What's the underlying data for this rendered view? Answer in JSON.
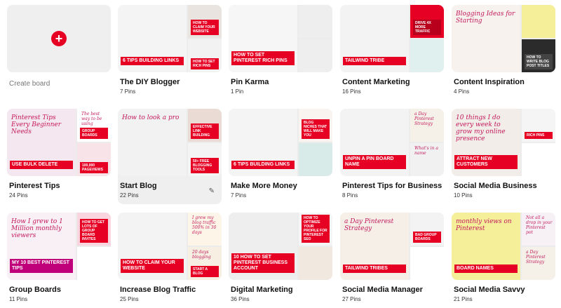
{
  "create": {
    "label": "Create board",
    "plus": "+"
  },
  "edit_glyph": "✎",
  "accent": "#e60023",
  "boards": [
    {
      "title": "The DIY Blogger",
      "count": "7 Pins",
      "tiles": [
        {
          "bg": "#f4f4f4",
          "band": "6 TIPS BUILDING LINKS",
          "bandColor": "#e60023",
          "script": ""
        },
        {
          "bg": "#e9e4df",
          "band": "HOW TO CLAIM YOUR WEBSITE",
          "bandColor": "#e60023",
          "script": ""
        },
        {
          "bg": "#f2f2f2",
          "band": "HOW TO SET RICH PINS",
          "bandColor": "#e60023",
          "script": ""
        }
      ]
    },
    {
      "title": "Pin Karma",
      "count": "1 Pin",
      "tiles": [
        {
          "bg": "#f6f6f6",
          "band": "HOW TO SET PINTEREST RICH PINS",
          "bandColor": "#e60023",
          "script": ""
        },
        {
          "bg": "#eeeeee",
          "band": "",
          "bandColor": "#e60023",
          "script": ""
        },
        {
          "bg": "#eeeeee",
          "band": "",
          "bandColor": "#e60023",
          "script": ""
        }
      ]
    },
    {
      "title": "Content Marketing",
      "count": "16 Pins",
      "tiles": [
        {
          "bg": "#f3f3f3",
          "band": "TAILWIND TRIBE",
          "bandColor": "#e60023",
          "script": ""
        },
        {
          "bg": "#e60023",
          "band": "DRIVE 4X MORE TRAFFIC",
          "bandColor": "#b8001c",
          "script": ""
        },
        {
          "bg": "#dff0ee",
          "band": "",
          "bandColor": "#e60023",
          "script": ""
        }
      ]
    },
    {
      "title": "Content Inspiration",
      "count": "4 Pins",
      "tiles": [
        {
          "bg": "#f7f2ee",
          "band": "",
          "bandColor": "#e60023",
          "script": "Blogging Ideas for Starting"
        },
        {
          "bg": "#f6ef9a",
          "band": "",
          "bandColor": "#e60023",
          "script": ""
        },
        {
          "bg": "#2b2b2b",
          "band": "HOW TO WRITE BLOG POST TITLES",
          "bandColor": "#444444",
          "script": ""
        }
      ]
    },
    {
      "title": "Pinterest Tips",
      "count": "24 Pins",
      "tiles": [
        {
          "bg": "#f5e7f0",
          "band": "USE BULK DELETE",
          "bandColor": "#e60023",
          "script": "Pinterest Tips Every Beginner Needs"
        },
        {
          "bg": "#ffffff",
          "band": "GROUP BOARDS",
          "bandColor": "#e60023",
          "script": "The best way to be using"
        },
        {
          "bg": "#f8e3e8",
          "band": "100,000 PAGEVIEWS",
          "bandColor": "#e60023",
          "script": ""
        }
      ]
    },
    {
      "title": "Start Blog",
      "count": "22 Pins",
      "tiles": [
        {
          "bg": "#f2f2f2",
          "band": "",
          "bandColor": "#e60023",
          "script": "How to look a pro"
        },
        {
          "bg": "#eadcd5",
          "band": "EFFECTIVE LINK BUILDING",
          "bandColor": "#e60023",
          "script": ""
        },
        {
          "bg": "#f4f4f4",
          "band": "50+ FREE BLOGGING TOOLS",
          "bandColor": "#e60023",
          "script": ""
        }
      ]
    },
    {
      "title": "Make More Money",
      "count": "7 Pins",
      "tiles": [
        {
          "bg": "#f4f4f4",
          "band": "6 TIPS BUILDING LINKS",
          "bandColor": "#e60023",
          "script": ""
        },
        {
          "bg": "#f9f4ef",
          "band": "BLOG NICHES THAT WILL MAKE YOU",
          "bandColor": "#e60023",
          "script": ""
        },
        {
          "bg": "#d9ebe8",
          "band": "",
          "bandColor": "#e60023",
          "script": ""
        }
      ]
    },
    {
      "title": "Pinterest Tips for Business",
      "count": "8 Pins",
      "tiles": [
        {
          "bg": "#f3f3f3",
          "band": "UNPIN A PIN BOARD NAME",
          "bandColor": "#e60023",
          "script": ""
        },
        {
          "bg": "#f5f0e8",
          "band": "",
          "bandColor": "#e60023",
          "script": "a Day Pinterest Strategy"
        },
        {
          "bg": "#f1f1f1",
          "band": "",
          "bandColor": "#e60023",
          "script": "What's in a name"
        }
      ]
    },
    {
      "title": "Social Media Business",
      "count": "10 Pins",
      "tiles": [
        {
          "bg": "#f2ede9",
          "band": "ATTRACT NEW CUSTOMERS",
          "bandColor": "#e60023",
          "script": "10 things I do every week to grow my online presence"
        },
        {
          "bg": "#f5f5f5",
          "band": "RICH PINS",
          "bandColor": "#e60023",
          "script": ""
        },
        {
          "bg": "#ffffff",
          "band": "",
          "bandColor": "#e60023",
          "script": ""
        }
      ]
    },
    {
      "title": "Group Boards",
      "count": "11 Pins",
      "tiles": [
        {
          "bg": "#f9f0f6",
          "band": "MY 10 BEST PINTEREST TIPS",
          "bandColor": "#c0007a",
          "script": "How I grew to 1 Million monthly viewers"
        },
        {
          "bg": "#f9d6df",
          "band": "HOW TO GET LOTS OF GROUP BOARD INVITES",
          "bandColor": "#e60023",
          "script": ""
        },
        {
          "bg": "#ffffff",
          "band": "",
          "bandColor": "#e60023",
          "script": ""
        }
      ]
    },
    {
      "title": "Increase Blog Traffic",
      "count": "25 Pins",
      "tiles": [
        {
          "bg": "#f3f3f3",
          "band": "HOW TO CLAIM YOUR WEBSITE",
          "bandColor": "#e60023",
          "script": ""
        },
        {
          "bg": "#fdf6e8",
          "band": "",
          "bandColor": "#e60023",
          "script": "I grew my blog traffic 500% in 30 days"
        },
        {
          "bg": "#f6efe2",
          "band": "START A BLOG",
          "bandColor": "#e60023",
          "script": "20 days blogging"
        }
      ]
    },
    {
      "title": "Digital Marketing",
      "count": "36 Pins",
      "tiles": [
        {
          "bg": "#eeeeee",
          "band": "10 HOW TO SET PINTEREST BUSINESS ACCOUNT",
          "bandColor": "#e60023",
          "script": ""
        },
        {
          "bg": "#f5f5f5",
          "band": "HOW TO OPTIMIZE YOUR PROFILE FOR PINTEREST SEO",
          "bandColor": "#e60023",
          "script": ""
        },
        {
          "bg": "#f1e9e0",
          "band": "",
          "bandColor": "#e60023",
          "script": ""
        }
      ]
    },
    {
      "title": "Social Media Manager",
      "count": "27 Pins",
      "tiles": [
        {
          "bg": "#f5efe8",
          "band": "TAILWIND TRIBES",
          "bandColor": "#e60023",
          "script": "a Day Pinterest Strategy"
        },
        {
          "bg": "#f3f3f3",
          "band": "BAD GROUP BOARDS",
          "bandColor": "#e60023",
          "script": ""
        },
        {
          "bg": "#ffffff",
          "band": "",
          "bandColor": "#e60023",
          "script": ""
        }
      ]
    },
    {
      "title": "Social Media Savvy",
      "count": "21 Pins",
      "tiles": [
        {
          "bg": "#f6ef9a",
          "band": "BOARD NAMES",
          "bandColor": "#e60023",
          "script": "monthly views on Pinterest"
        },
        {
          "bg": "#f7f1f5",
          "band": "",
          "bandColor": "#e60023",
          "script": "Not all a drop in your Pinterest pot"
        },
        {
          "bg": "#f5f0e8",
          "band": "",
          "bandColor": "#e60023",
          "script": "a Day Pinterest Strategy"
        }
      ]
    }
  ]
}
